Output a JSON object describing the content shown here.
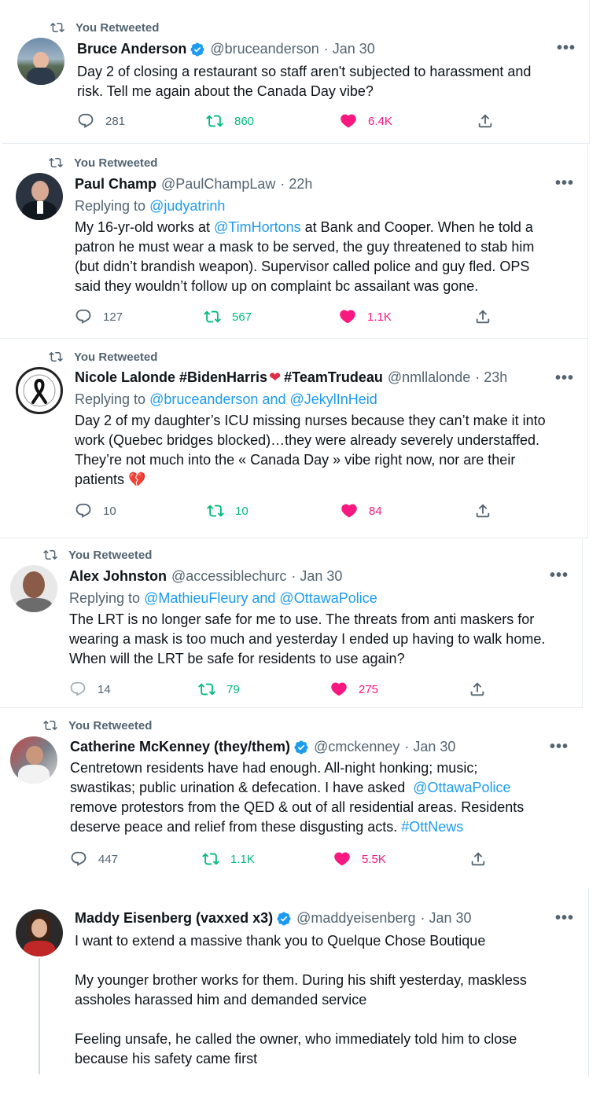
{
  "retweet_label": "You Retweeted",
  "more_label": "•••",
  "tweets": [
    {
      "name": "Bruce Anderson",
      "handle": "@bruceanderson",
      "time": "· Jan 30",
      "lines": [
        "Day 2 of closing a restaurant so staff aren't subjected to harassment and",
        "risk. Tell me again about the Canada Day vibe?"
      ],
      "replies": "281",
      "retweets": "860",
      "likes": "6.4K"
    },
    {
      "name": "Paul Champ",
      "handle": "@PaulChampLaw",
      "time": "· 22h",
      "replying_prefix": "Replying to",
      "replying_to": "@judyatrinh",
      "line1_pre": "My 16-yr-old works at ",
      "line1_link": "@TimHortons",
      "line1_post": " at Bank and Cooper. When he told a",
      "lines": [
        "patron he must wear a mask to be served, the guy threatened to stab him",
        "(but didn’t brandish weapon). Supervisor called police and guy fled. OPS",
        "said they wouldn’t follow up on complaint bc assailant was gone."
      ],
      "replies": "127",
      "retweets": "567",
      "likes": "1.1K"
    },
    {
      "name": "Nicole Lalonde #BidenHarris",
      "name_emoji": "❤",
      "name_suffix": "#TeamTrudeau",
      "handle": "@nmllalonde",
      "time": "· 23h",
      "replying_prefix": "Replying to",
      "replying_to": "@bruceanderson and @JekylInHeid",
      "lines": [
        "Day 2 of my daughter’s ICU missing nurses because they can’t make it into",
        "work (Quebec bridges blocked)…they were already severely understaffed.",
        "They’re not much into the « Canada Day » vibe right now, nor are their"
      ],
      "last_line": "patients",
      "last_emoji": "💔",
      "replies": "10",
      "retweets": "10",
      "likes": "84"
    },
    {
      "name": "Alex Johnston",
      "handle": "@accessiblechurc",
      "time": "· Jan 30",
      "replying_prefix": "Replying to",
      "replying_to": "@MathieuFleury and @OttawaPolice",
      "lines": [
        "The LRT is no longer safe for me to use. The threats from anti maskers for",
        "wearing a mask is too much and yesterday I ended up having to walk home.",
        "When will the LRT be safe for residents to use again?"
      ],
      "replies": "14",
      "retweets": "79",
      "likes": "275"
    },
    {
      "name": "Catherine McKenney (they/them)",
      "handle": "@cmckenney",
      "time": "· Jan 30",
      "lines": [
        "Centretown residents have had enough. All-night honking; music;"
      ],
      "line2_pre": "swastikas; public urination & defecation. I have asked  ",
      "line2_link": "@OttawaPolice",
      "lines_b": [
        "remove protestors from the QED & out of all residential areas. Residents"
      ],
      "line4_pre": "deserve peace and relief from these disgusting acts. ",
      "line4_link": "#OttNews",
      "replies": "447",
      "retweets": "1.1K",
      "likes": "5.5K"
    },
    {
      "name": "Maddy Eisenberg (vaxxed x3)",
      "handle": "@maddyeisenberg",
      "time": "· Jan 30",
      "para1": "I want to extend a massive thank you to Quelque Chose Boutique",
      "para2": [
        "My younger brother works for them. During his shift yesterday, maskless",
        "assholes harassed him and demanded service"
      ],
      "para3": [
        "Feeling unsafe, he called the owner, who immediately told him to close",
        "because his safety came first"
      ]
    }
  ],
  "colors": {
    "green": "#00ba7c",
    "pink": "#f91880",
    "blue": "#1d9bf0",
    "gray": "#536471"
  }
}
